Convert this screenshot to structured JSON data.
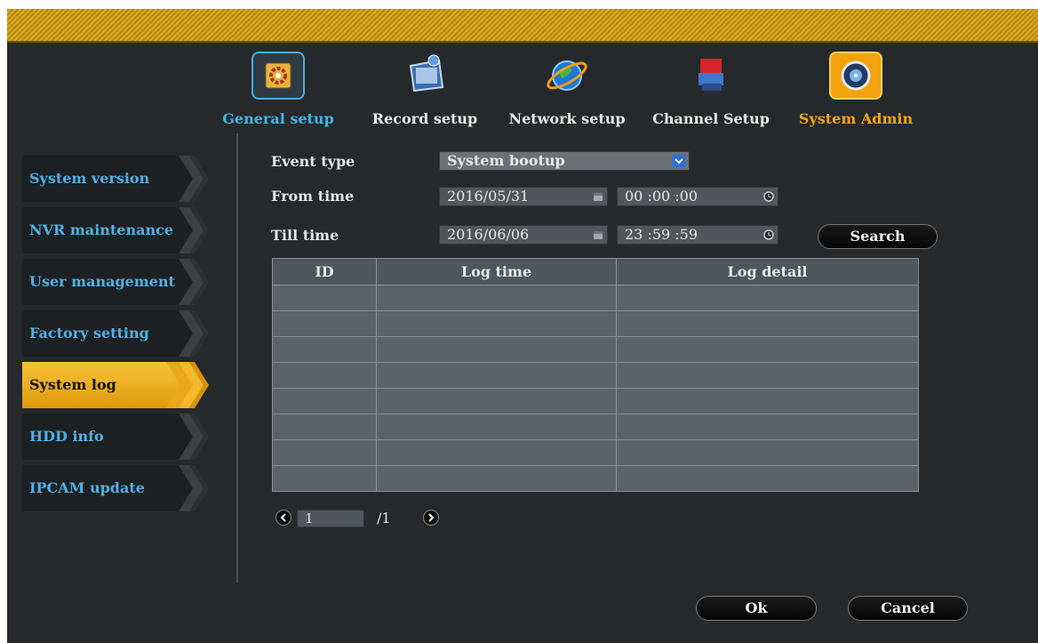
{
  "tabs": [
    {
      "label": "General setup",
      "icon": "gear-settings-icon"
    },
    {
      "label": "Record setup",
      "icon": "film-reel-icon"
    },
    {
      "label": "Network setup",
      "icon": "globe-icon"
    },
    {
      "label": "Channel Setup",
      "icon": "camera-channel-icon"
    },
    {
      "label": "System Admin",
      "icon": "admin-disk-icon"
    }
  ],
  "active_tab": "System Admin",
  "sidebar": {
    "items": [
      {
        "label": "System version"
      },
      {
        "label": "NVR maintenance"
      },
      {
        "label": "User management"
      },
      {
        "label": "Factory setting"
      },
      {
        "label": "System log"
      },
      {
        "label": "HDD info"
      },
      {
        "label": "IPCAM update"
      }
    ],
    "active": "System log"
  },
  "form": {
    "event_type_label": "Event type",
    "event_type_value": "System bootup",
    "from_label": "From time",
    "from_date": "2016/05/31",
    "from_time": "00 :00 :00",
    "till_label": "Till time",
    "till_date": "2016/06/06",
    "till_time": "23 :59 :59",
    "search_label": "Search"
  },
  "table": {
    "headers": [
      "ID",
      "Log time",
      "Log detail"
    ],
    "rows": [
      [
        "",
        "",
        ""
      ],
      [
        "",
        "",
        ""
      ],
      [
        "",
        "",
        ""
      ],
      [
        "",
        "",
        ""
      ],
      [
        "",
        "",
        ""
      ],
      [
        "",
        "",
        ""
      ],
      [
        "",
        "",
        ""
      ],
      [
        "",
        "",
        ""
      ]
    ]
  },
  "pager": {
    "current": "1",
    "total": "/1"
  },
  "footer": {
    "ok_label": "Ok",
    "cancel_label": "Cancel"
  },
  "colors": {
    "accent_blue": "#3fb6ea",
    "accent_orange": "#f3a50a",
    "background": "#25292b",
    "title_bar": "#d8a826"
  }
}
